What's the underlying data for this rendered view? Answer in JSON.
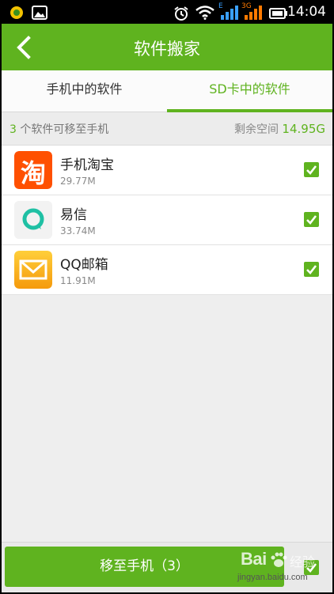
{
  "status_bar": {
    "time": "14:04",
    "network_label": "3G",
    "signal_label": "E"
  },
  "header": {
    "title": "软件搬家"
  },
  "tabs": [
    {
      "label": "手机中的软件",
      "selected": false
    },
    {
      "label": "SD卡中的软件",
      "selected": true
    }
  ],
  "info_bar": {
    "count": "3",
    "count_suffix": " 个软件可移至手机",
    "space_label": "剩余空间 ",
    "space_value": "14.95G"
  },
  "apps": [
    {
      "name": "手机淘宝",
      "size": "29.77M",
      "icon": "taobao-icon",
      "icon_badge": "淘",
      "checked": true
    },
    {
      "name": "易信",
      "size": "33.74M",
      "icon": "yixin-icon",
      "checked": true
    },
    {
      "name": "QQ邮箱",
      "size": "11.91M",
      "icon": "qqmail-icon",
      "checked": true
    }
  ],
  "bottom": {
    "move_button_label": "移至手机（3）",
    "select_all_checked": true
  },
  "watermark": {
    "brand": "Bai",
    "suffix": "经验",
    "url": "jingyan.baidu.com"
  },
  "colors": {
    "accent": "#5fb31f",
    "background": "#eeeeee",
    "taobao": "#ff5000",
    "yixin": "#1fc0a4",
    "qqmail": "#f7a814"
  }
}
